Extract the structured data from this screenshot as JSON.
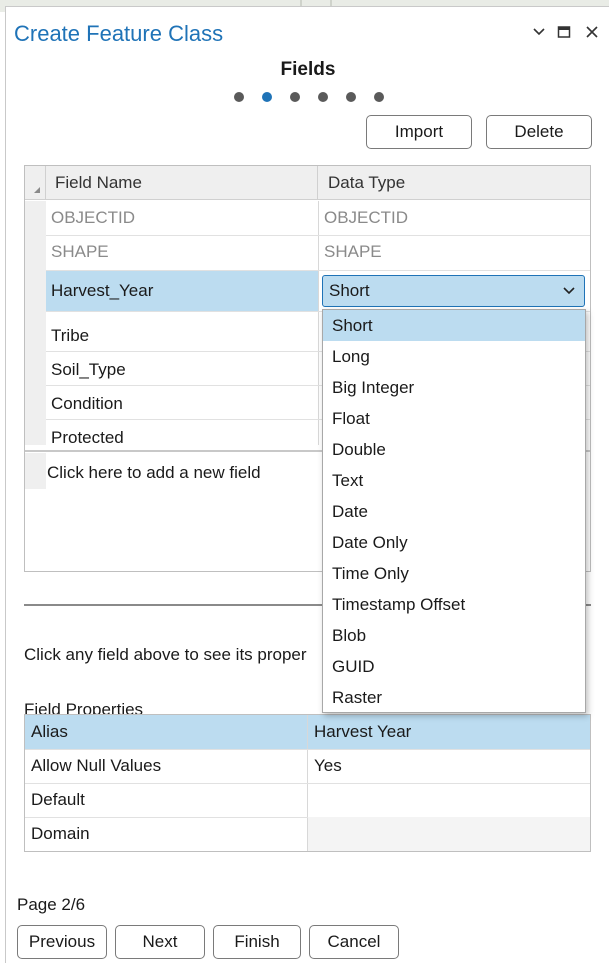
{
  "window": {
    "title": "Create Feature Class",
    "controls": [
      "chevron-down",
      "maximize",
      "close"
    ]
  },
  "step": {
    "title": "Fields",
    "total_steps": 6,
    "current_step": 2
  },
  "toolbar": {
    "import_label": "Import",
    "delete_label": "Delete"
  },
  "fields_grid": {
    "columns": [
      "Field Name",
      "Data Type"
    ],
    "rows": [
      {
        "name": "OBJECTID",
        "type": "OBJECTID",
        "system": true
      },
      {
        "name": "SHAPE",
        "type": "SHAPE",
        "system": true
      },
      {
        "name": "Harvest_Year",
        "type": "Short",
        "selected": true
      },
      {
        "name": "Tribe",
        "type": ""
      },
      {
        "name": "Soil_Type",
        "type": ""
      },
      {
        "name": "Condition",
        "type": ""
      },
      {
        "name": "Protected",
        "type": ""
      }
    ],
    "add_new_label": "Click here to add a new field"
  },
  "data_type_dropdown": {
    "current_value": "Short",
    "options": [
      "Short",
      "Long",
      "Big Integer",
      "Float",
      "Double",
      "Text",
      "Date",
      "Date Only",
      "Time Only",
      "Timestamp Offset",
      "Blob",
      "GUID",
      "Raster"
    ],
    "highlighted": "Short"
  },
  "hint_text": "Click any field above to see its proper",
  "field_properties": {
    "label": "Field Properties",
    "rows": [
      {
        "name": "Alias",
        "value": "Harvest Year",
        "selected": true
      },
      {
        "name": "Allow Null Values",
        "value": "Yes"
      },
      {
        "name": "Default",
        "value": ""
      },
      {
        "name": "Domain",
        "value": ""
      }
    ]
  },
  "footer": {
    "page_label": "Page 2/6",
    "previous_label": "Previous",
    "next_label": "Next",
    "finish_label": "Finish",
    "cancel_label": "Cancel"
  },
  "colors": {
    "accent": "#1f73b7",
    "selection": "#bcdcf0",
    "dim_text": "#8a8a8a"
  }
}
